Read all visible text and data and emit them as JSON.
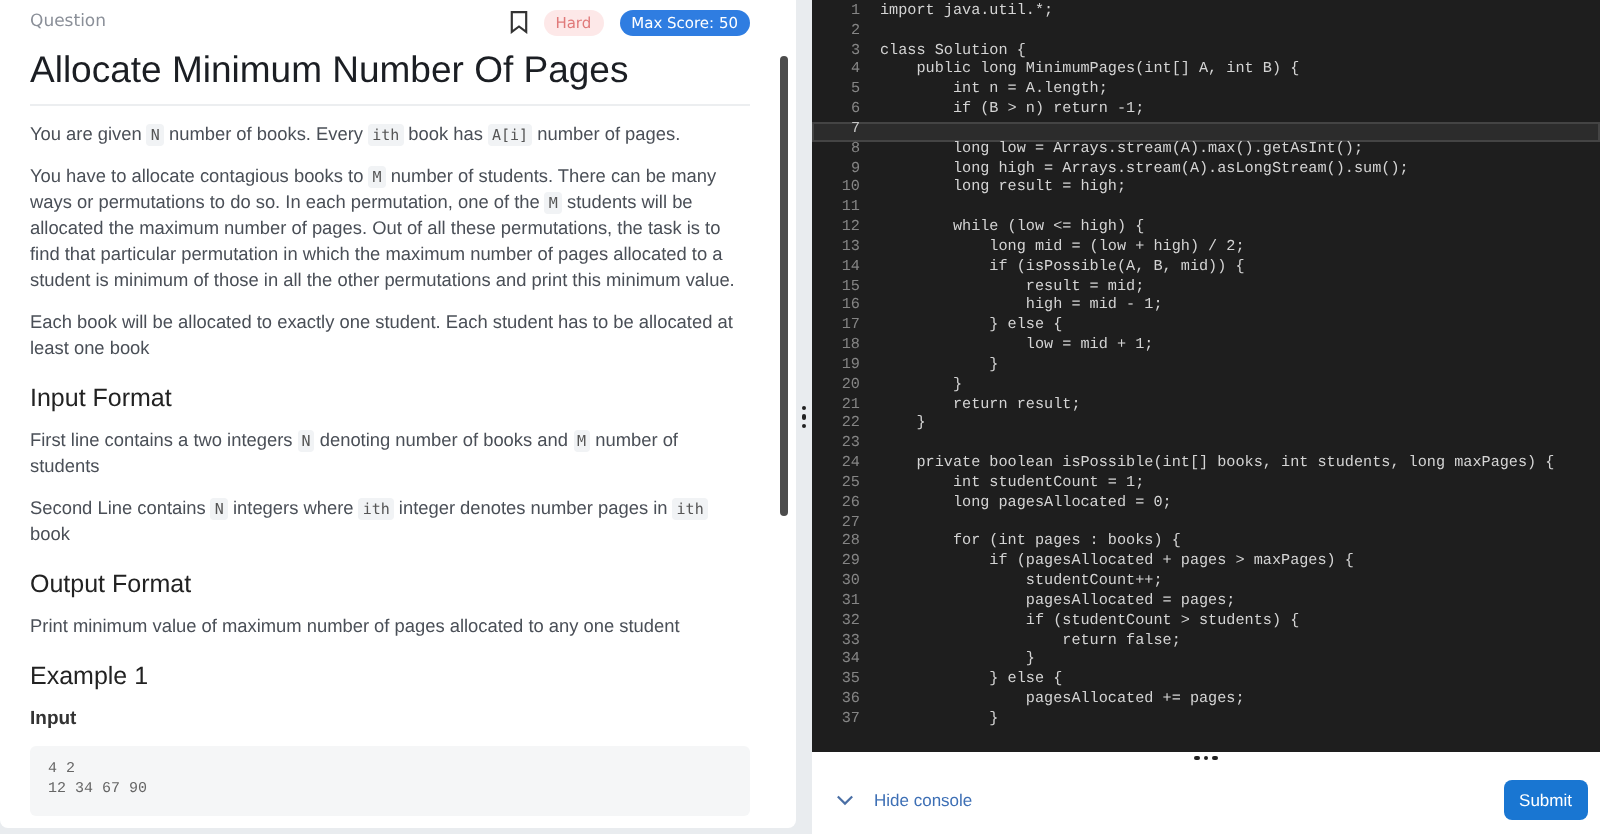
{
  "header": {
    "label": "Question",
    "bookmarked": false,
    "difficulty": "Hard",
    "max_score": "Max Score: 50"
  },
  "title": "Allocate Minimum Number Of Pages",
  "sections": [
    {
      "kind": "paragraph",
      "parts": [
        {
          "text": "You are given ",
          "code": false
        },
        {
          "text": "N",
          "code": true
        },
        {
          "text": " number of books. Every ",
          "code": false
        },
        {
          "text": "ith",
          "code": true
        },
        {
          "text": " book has ",
          "code": false
        },
        {
          "text": "A[i]",
          "code": true
        },
        {
          "text": " number of pages.",
          "code": false
        }
      ]
    },
    {
      "kind": "paragraph",
      "parts": [
        {
          "text": "You have to allocate contagious books to ",
          "code": false
        },
        {
          "text": "M",
          "code": true
        },
        {
          "text": " number of students. There can be many ways or permutations to do so. In each permutation, one of the ",
          "code": false
        },
        {
          "text": "M",
          "code": true
        },
        {
          "text": " students will be allocated the maximum number of pages. Out of all these permutations, the task is to find that particular permutation in which the maximum number of pages allocated to a student is minimum of those in all the other permutations and print this minimum value.",
          "code": false
        }
      ]
    },
    {
      "kind": "paragraph",
      "parts": [
        {
          "text": "Each book will be allocated to exactly one student. Each student has to be allocated at least one book",
          "code": false
        }
      ]
    },
    {
      "kind": "heading",
      "text": "Input Format"
    },
    {
      "kind": "paragraph",
      "parts": [
        {
          "text": "First line contains a two integers ",
          "code": false
        },
        {
          "text": "N",
          "code": true
        },
        {
          "text": " denoting number of books and ",
          "code": false
        },
        {
          "text": "M",
          "code": true
        },
        {
          "text": " number of students",
          "code": false
        }
      ]
    },
    {
      "kind": "paragraph",
      "parts": [
        {
          "text": "Second Line contains ",
          "code": false
        },
        {
          "text": "N",
          "code": true
        },
        {
          "text": " integers where ",
          "code": false
        },
        {
          "text": "ith",
          "code": true
        },
        {
          "text": " integer denotes number pages in ",
          "code": false
        },
        {
          "text": "ith",
          "code": true
        },
        {
          "text": " book",
          "code": false
        }
      ]
    },
    {
      "kind": "heading",
      "text": "Output Format"
    },
    {
      "kind": "paragraph",
      "parts": [
        {
          "text": "Print minimum value of maximum number of pages allocated to any one student",
          "code": false
        }
      ]
    },
    {
      "kind": "heading",
      "text": "Example 1"
    },
    {
      "kind": "subheading",
      "text": "Input"
    },
    {
      "kind": "codeblock",
      "lines": [
        "4 2",
        "12 34 67 90"
      ]
    }
  ],
  "editor": {
    "lines": [
      {
        "number": "1",
        "text": "import java.util.*;",
        "current": false
      },
      {
        "number": "2",
        "current": false
      },
      {
        "number": "3",
        "text": "class Solution {",
        "current": false
      },
      {
        "number": "4",
        "text": "    public long MinimumPages(int[] A, int B) {",
        "current": false
      },
      {
        "number": "5",
        "text": "        int n = A.length;",
        "current": false
      },
      {
        "number": "6",
        "text": "        if (B > n) return -1;",
        "current": false
      },
      {
        "number": "7",
        "current": true
      },
      {
        "number": "8",
        "text": "        long low = Arrays.stream(A).max().getAsInt();",
        "current": false
      },
      {
        "number": "9",
        "text": "        long high = Arrays.stream(A).asLongStream().sum();",
        "current": false
      },
      {
        "number": "10",
        "text": "        long result = high;",
        "current": false
      },
      {
        "number": "11",
        "current": false
      },
      {
        "number": "12",
        "text": "        while (low <= high) {",
        "current": false
      },
      {
        "number": "13",
        "text": "            long mid = (low + high) / 2;",
        "current": false
      },
      {
        "number": "14",
        "text": "            if (isPossible(A, B, mid)) {",
        "current": false
      },
      {
        "number": "15",
        "text": "                result = mid;",
        "current": false
      },
      {
        "number": "16",
        "text": "                high = mid - 1;",
        "current": false
      },
      {
        "number": "17",
        "text": "            } else {",
        "current": false
      },
      {
        "number": "18",
        "text": "                low = mid + 1;",
        "current": false
      },
      {
        "number": "19",
        "text": "            }",
        "current": false
      },
      {
        "number": "20",
        "text": "        }",
        "current": false
      },
      {
        "number": "21",
        "text": "        return result;",
        "current": false
      },
      {
        "number": "22",
        "text": "    }",
        "current": false
      },
      {
        "number": "23",
        "current": false
      },
      {
        "number": "24",
        "text": "    private boolean isPossible(int[] books, int students, long maxPages) {",
        "current": false
      },
      {
        "number": "25",
        "text": "        int studentCount = 1;",
        "current": false
      },
      {
        "number": "26",
        "text": "        long pagesAllocated = 0;",
        "current": false
      },
      {
        "number": "27",
        "current": false
      },
      {
        "number": "28",
        "text": "        for (int pages : books) {",
        "current": false
      },
      {
        "number": "29",
        "text": "            if (pagesAllocated + pages > maxPages) {",
        "current": false
      },
      {
        "number": "30",
        "text": "                studentCount++;",
        "current": false
      },
      {
        "number": "31",
        "text": "                pagesAllocated = pages;",
        "current": false
      },
      {
        "number": "32",
        "text": "                if (studentCount > students) {",
        "current": false
      },
      {
        "number": "33",
        "text": "                    return false;",
        "current": false
      },
      {
        "number": "34",
        "text": "                }",
        "current": false
      },
      {
        "number": "35",
        "text": "            } else {",
        "current": false
      },
      {
        "number": "36",
        "text": "                pagesAllocated += pages;",
        "current": false
      },
      {
        "number": "37",
        "text": "            }",
        "current": false
      }
    ]
  },
  "console": {
    "toggle": "Hide console",
    "submit": "Submit"
  }
}
